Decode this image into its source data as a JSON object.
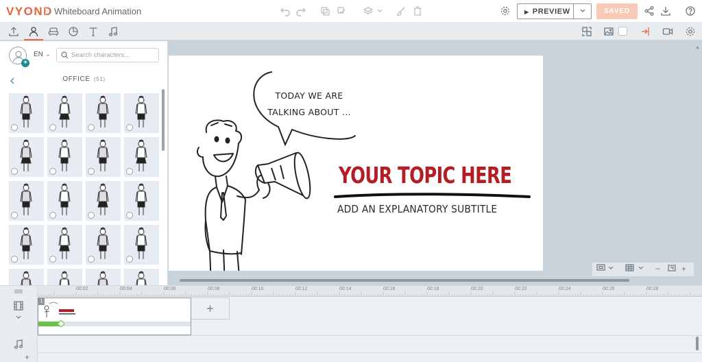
{
  "app": {
    "logo": "VYOND",
    "title": "Whiteboard Animation"
  },
  "top_actions": {
    "preview_label": "PREVIEW",
    "saved_label": "SAVED",
    "icons": [
      "undo-icon",
      "redo-icon",
      "copy-icon",
      "paste-icon",
      "layers-icon",
      "brush-icon",
      "trash-icon",
      "settings-icon",
      "share-icon",
      "download-icon",
      "help-icon"
    ]
  },
  "library_tabs": [
    "upload-icon",
    "characters-icon",
    "props-icon",
    "charts-icon",
    "text-icon",
    "audio-icon"
  ],
  "right_tools": [
    "swap-icon",
    "image-icon",
    "exit-icon",
    "camera-icon",
    "gear-icon"
  ],
  "panel": {
    "language": "EN",
    "search_placeholder": "Search characters...",
    "category": "OFFICE",
    "category_count": "(51)",
    "tiles": 20
  },
  "stage": {
    "bubble_line1": "TODAY WE ARE",
    "bubble_line2": "TALKING ABOUT ...",
    "title": "YOUR TOPIC HERE",
    "subtitle": "ADD AN EXPLANATORY SUBTITLE",
    "title_color": "#b51d24"
  },
  "timeline": {
    "ticks": [
      "00:02",
      "00:04",
      "00:06",
      "00:08",
      "00:10",
      "00:12",
      "00:14",
      "00:16",
      "00:18",
      "00:20",
      "00:22",
      "00:24",
      "00:26",
      "00:28"
    ],
    "scene_number": "1",
    "scene_progress": 0.15,
    "add_label": "+"
  },
  "zoom": {
    "minus": "−",
    "plus": "+"
  },
  "colors": {
    "accent": "#e8623a",
    "progress": "#6cc24a",
    "teal": "#1a8a8e"
  }
}
